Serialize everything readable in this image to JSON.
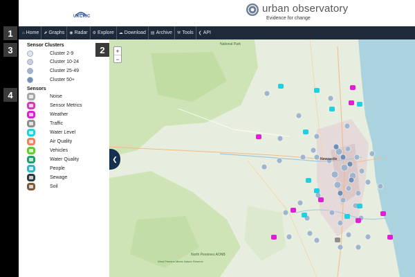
{
  "header": {
    "ukcric": "UKCRIC",
    "title": "urban observatory",
    "subtitle": "Evidence for change"
  },
  "nav": [
    {
      "label": "Home",
      "icon": "⌂"
    },
    {
      "label": "Graphs",
      "icon": "⬈"
    },
    {
      "label": "Radar",
      "icon": "◉"
    },
    {
      "label": "Explore",
      "icon": "⚙"
    },
    {
      "label": "Download",
      "icon": "☁"
    },
    {
      "label": "Archive",
      "icon": "▤"
    },
    {
      "label": "Tools",
      "icon": "⚒"
    },
    {
      "label": "API",
      "icon": "❮"
    }
  ],
  "callouts": [
    "1",
    "2",
    "3",
    "4"
  ],
  "clusters": {
    "heading": "Sensor Clusters",
    "items": [
      {
        "label": "Cluster 2-9",
        "color": "#dfe5ee"
      },
      {
        "label": "Cluster 10-24",
        "color": "#c5d1e1"
      },
      {
        "label": "Cluster 25-49",
        "color": "#9fb4cd"
      },
      {
        "label": "Cluster 50+",
        "color": "#6f8fb4"
      }
    ]
  },
  "sensors": {
    "heading": "Sensors",
    "items": [
      {
        "label": "Noise",
        "color": "#a6a6a6",
        "icon": "noise-icon"
      },
      {
        "label": "Sensor Metrics",
        "color": "#d43cb4",
        "icon": "sensor-metrics-icon"
      },
      {
        "label": "Weather",
        "color": "#e01fd2",
        "icon": "weather-icon"
      },
      {
        "label": "Traffic",
        "color": "#8e8e8e",
        "icon": "traffic-icon"
      },
      {
        "label": "Water Level",
        "color": "#20d0e0",
        "icon": "water-level-icon"
      },
      {
        "label": "Air Quality",
        "color": "#f08060",
        "icon": "air-quality-icon"
      },
      {
        "label": "Vehicles",
        "color": "#60cc30",
        "icon": "vehicles-icon"
      },
      {
        "label": "Water Quality",
        "color": "#1fa06a",
        "icon": "water-quality-icon"
      },
      {
        "label": "People",
        "color": "#2fb5c9",
        "icon": "people-icon"
      },
      {
        "label": "Sewage",
        "color": "#2d3b40",
        "icon": "sewage-icon"
      },
      {
        "label": "Soil",
        "color": "#7a5a3c",
        "icon": "soil-icon"
      }
    ]
  },
  "map": {
    "zoom_in": "+",
    "zoom_out": "−",
    "collapse": "❮",
    "labels": [
      "National Park",
      "Newcastle",
      "North Pennines AONB",
      "West Pennine Mines Nature Reserve"
    ]
  }
}
